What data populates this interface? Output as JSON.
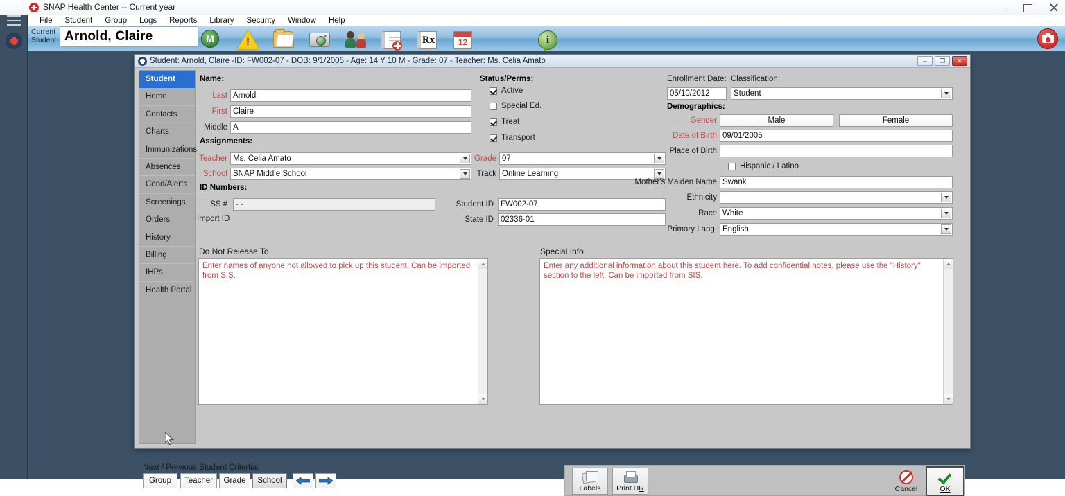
{
  "os": {
    "title": "SNAP Health Center -- Current year",
    "app_icon": "medical-cross-icon",
    "minimize": "–",
    "maximize": "□",
    "close": "✕"
  },
  "rail": {
    "hamburger": "menu-icon",
    "logo": "heart-shield-logo"
  },
  "menubar": {
    "items": [
      {
        "label": "File"
      },
      {
        "label": "Student"
      },
      {
        "label": "Group"
      },
      {
        "label": "Logs"
      },
      {
        "label": "Reports"
      },
      {
        "label": "Library"
      },
      {
        "label": "Security"
      },
      {
        "label": "Window"
      },
      {
        "label": "Help"
      }
    ]
  },
  "toolbar": {
    "current_student_label_line1": "Current",
    "current_student_label_line2": "Student",
    "current_student_value": "Arnold, Claire",
    "icons": [
      {
        "name": "medicaid-m-icon",
        "glyph": "M"
      },
      {
        "name": "alert-warning-icon",
        "glyph": "!"
      },
      {
        "name": "open-folder-icon",
        "glyph": ""
      },
      {
        "name": "camera-icon",
        "glyph": ""
      },
      {
        "name": "contacts-people-icon",
        "glyph": ""
      },
      {
        "name": "add-note-icon",
        "glyph": ""
      },
      {
        "name": "prescription-rx-icon",
        "glyph": "Rx"
      },
      {
        "name": "calendar-icon",
        "glyph": "12"
      },
      {
        "name": "information-icon",
        "glyph": "i"
      }
    ],
    "kit_icon": "first-aid-kit-icon"
  },
  "dialog": {
    "title": "Student: Arnold, Claire -ID: FW002-07 - DOB: 9/1/2005 - Age: 14 Y 10 M - Grade: 07 - Teacher: Ms. Celia Amato",
    "icon": "student-record-icon",
    "window_buttons": {
      "minimize": "–",
      "restore": "❐",
      "close": "✕"
    }
  },
  "sidebar": {
    "items": [
      {
        "label": "Student",
        "active": true
      },
      {
        "label": "Home",
        "active": false
      },
      {
        "label": "Contacts",
        "active": false
      },
      {
        "label": "Charts",
        "active": false
      },
      {
        "label": "Immunizations",
        "active": false
      },
      {
        "label": "Absences",
        "active": false
      },
      {
        "label": "Cond/Alerts",
        "active": false
      },
      {
        "label": "Screenings",
        "active": false
      },
      {
        "label": "Orders",
        "active": false
      },
      {
        "label": "History",
        "active": false
      },
      {
        "label": "Billing",
        "active": false
      },
      {
        "label": "IHPs",
        "active": false
      },
      {
        "label": "Health Portal",
        "active": false
      }
    ]
  },
  "form": {
    "name_section": {
      "header": "Name:",
      "last_label": "Last",
      "last_value": "Arnold",
      "first_label": "First",
      "first_value": "Claire",
      "middle_label": "Middle",
      "middle_value": "A"
    },
    "assignments_section": {
      "header": "Assignments:",
      "teacher_label": "Teacher",
      "teacher_value": "Ms. Celia Amato",
      "school_label": "School",
      "school_value": "SNAP Middle School"
    },
    "id_section": {
      "header": "ID Numbers:",
      "ss_label": "SS #",
      "ss_value": "   -   -",
      "import_label": "Import ID",
      "import_value": "",
      "student_id_label": "Student ID",
      "student_id_value": "FW002-07",
      "state_id_label": "State ID",
      "state_id_value": "02336-01"
    },
    "status_section": {
      "header": "Status/Perms:",
      "checkboxes": [
        {
          "label": "Active",
          "checked": true
        },
        {
          "label": "Special Ed.",
          "checked": false
        },
        {
          "label": "Treat",
          "checked": true
        },
        {
          "label": "Transport",
          "checked": true
        }
      ],
      "grade_label": "Grade",
      "grade_value": "07",
      "track_label": "Track",
      "track_value": "Online Learning"
    },
    "enrollment_section": {
      "enrollment_label": "Enrollment Date:",
      "enrollment_value": "05/10/2012",
      "classification_label": "Classification:",
      "classification_value": "Student"
    },
    "demographics_section": {
      "header": "Demographics:",
      "gender_label": "Gender",
      "gender_male": "Male",
      "gender_female": "Female",
      "dob_label": "Date of Birth",
      "dob_value": "09/01/2005",
      "pob_label": "Place of Birth",
      "pob_value": "",
      "hispanic_label": "Hispanic / Latino",
      "hispanic_checked": false,
      "mother_label": "Mother's Maiden Name",
      "mother_value": "Swank",
      "ethnicity_label": "Ethnicity",
      "ethnicity_value": "",
      "race_label": "Race",
      "race_value": "White",
      "language_label": "Primary Lang.",
      "language_value": "English"
    },
    "do_not_release": {
      "label": "Do Not Release To",
      "placeholder": "Enter names of anyone not allowed to pick up this student. Can be imported from SIS."
    },
    "special_info": {
      "label": "Special Info",
      "placeholder": "Enter any additional information about this student here.  To add confidential notes, please use the \"History\" section to the left. Can be imported from SIS."
    }
  },
  "footer": {
    "criteria_header": "Next / Previous Student Critertia:",
    "criteria_buttons": [
      {
        "label": "Group",
        "selected": false
      },
      {
        "label": "Teacher",
        "selected": false
      },
      {
        "label": "Grade",
        "selected": false
      },
      {
        "label": "School",
        "selected": true
      }
    ],
    "prev_arrow": "arrow-left-icon",
    "next_arrow": "arrow-right-icon",
    "labels_button": "Labels",
    "print_button_pre": "Print H",
    "print_button_accel": "R",
    "cancel_button": "Cancel",
    "ok_button": "OK"
  },
  "colors": {
    "accent_blue": "#2a6fd0",
    "required_red": "#b94a48",
    "dialog_bg": "#c8c8c8",
    "workspace_bg": "#3d5166"
  }
}
